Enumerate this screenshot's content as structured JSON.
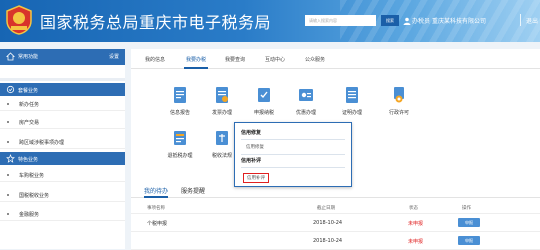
{
  "header": {
    "title": "国家税务总局重庆市电子税务局",
    "search_placeholder": "请输入搜索内容",
    "search_button": "搜索",
    "user_label": "办税员",
    "company": "重庆某科技有限公司",
    "logout": "退出"
  },
  "sidebar": {
    "common_functions": {
      "label": "常用功能",
      "action": "设置"
    },
    "sections": [
      {
        "label": "套餐业务",
        "items": [
          "新办任务",
          "房产交易",
          "跨区域涉税事项办理"
        ]
      },
      {
        "label": "特色业务",
        "items": [
          "车购税业务",
          "国税税收业务",
          "金融服务"
        ]
      }
    ]
  },
  "main": {
    "tabs": [
      "我的信息",
      "我要办税",
      "我要查询",
      "互动中心",
      "公众服务"
    ],
    "active_tab": 1,
    "functions": [
      {
        "label": "信息报告",
        "icon": "document-icon"
      },
      {
        "label": "发票办理",
        "icon": "invoice-icon"
      },
      {
        "label": "申报纳税",
        "icon": "tax-declaration-icon"
      },
      {
        "label": "优惠办理",
        "icon": "discount-icon"
      },
      {
        "label": "证明办理",
        "icon": "certificate-icon"
      },
      {
        "label": "行政许可",
        "icon": "license-icon"
      },
      {
        "label": "退抵税办理",
        "icon": "refund-icon"
      },
      {
        "label": "税收法规",
        "icon": "law-icon"
      }
    ],
    "dropdown": {
      "group1_title": "信用修复",
      "group1_items": [
        "信用修复"
      ],
      "group2_title": "信用补评",
      "group2_items": [
        "信用补评"
      ]
    },
    "todo": {
      "tabs": [
        "我的待办",
        "服务提醒"
      ],
      "columns": [
        "事项名称",
        "截止日期",
        "状态",
        "操作"
      ],
      "rows": [
        {
          "name": "个税申报",
          "date": "2018-10-24",
          "status": "未申报",
          "op": "申报"
        },
        {
          "name": "",
          "date": "2018-10-24",
          "status": "未申报",
          "op": "申报"
        }
      ]
    }
  },
  "colors": {
    "brand_blue": "#1a5fa8",
    "sidebar_blue": "#2d6db4",
    "alert_red": "#e02020"
  }
}
